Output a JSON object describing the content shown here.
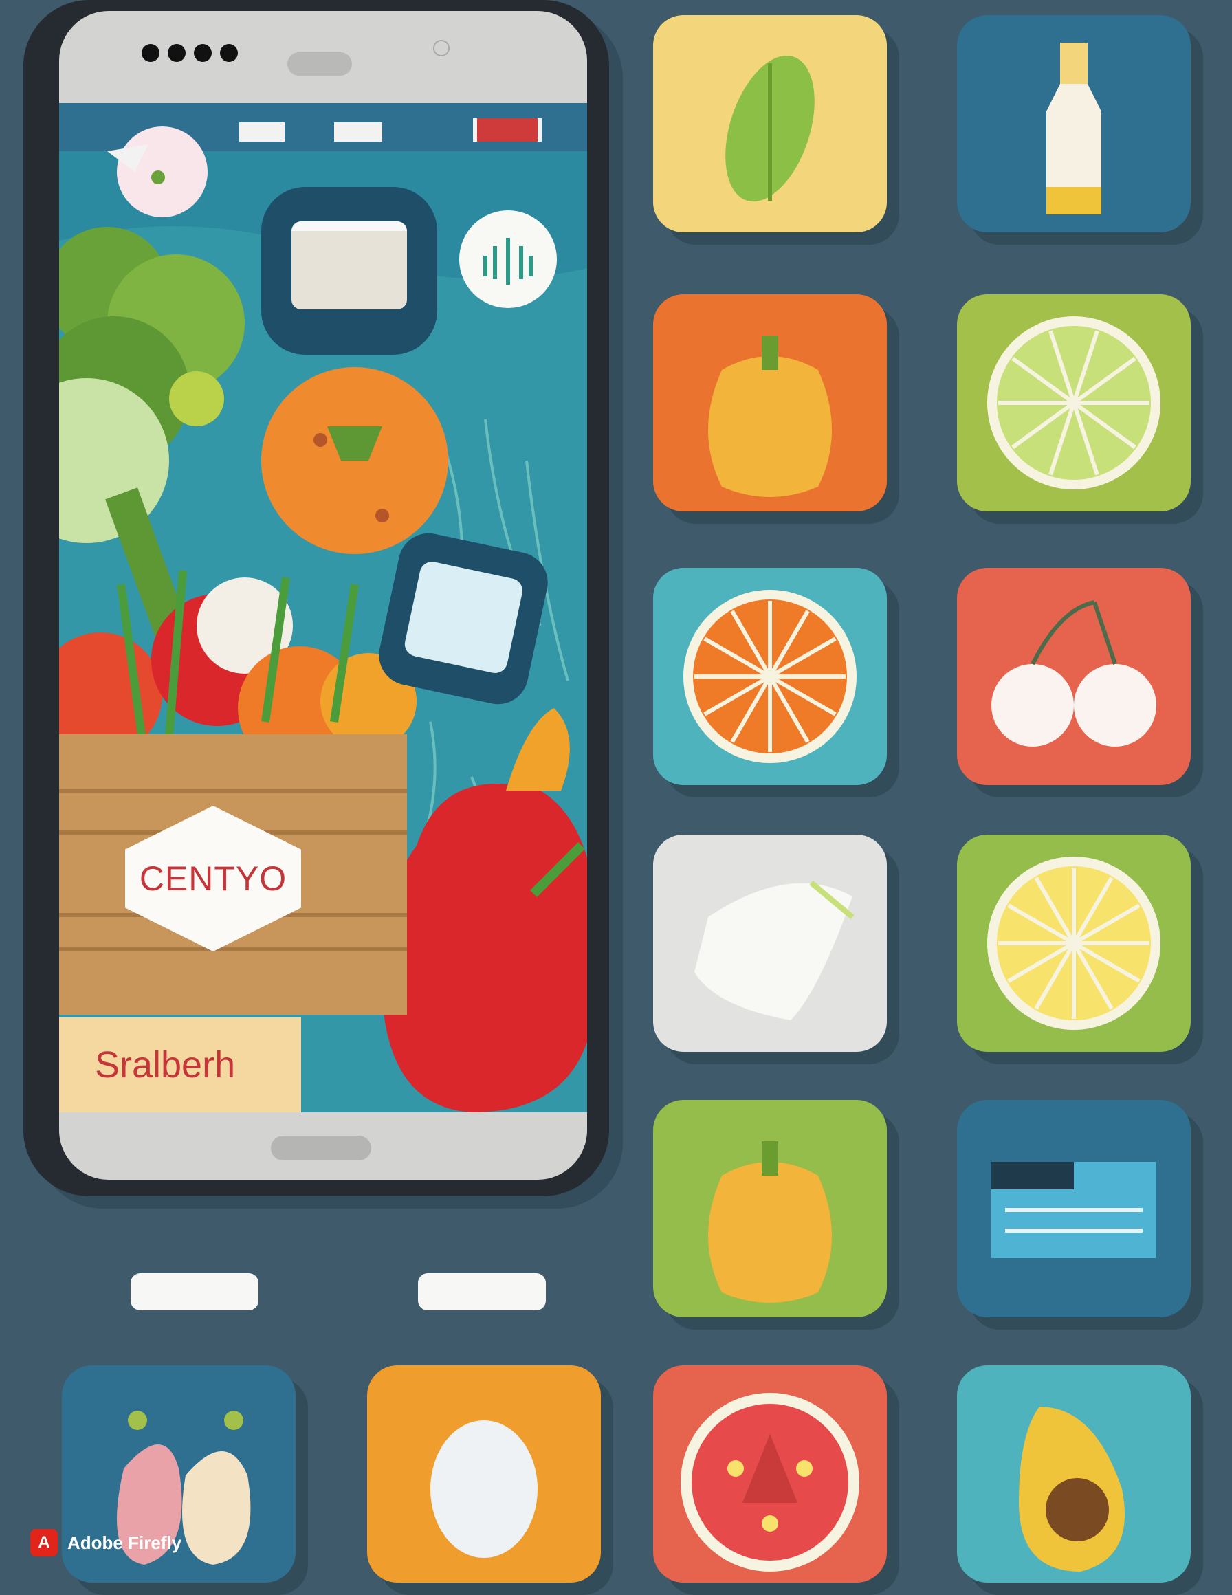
{
  "phone": {
    "crate_label": "CENTYO",
    "banner_text": "Sralberh"
  },
  "icon_tiles": [
    {
      "name": "leafy-green-icon",
      "color": "#f3d67b"
    },
    {
      "name": "bottle-icon",
      "color": "#2f6f8f"
    },
    {
      "name": "bell-pepper-icon",
      "color": "#e9732f"
    },
    {
      "name": "lime-slice-icon",
      "color": "#a3c04a"
    },
    {
      "name": "orange-slice-icon",
      "color": "#4fb3bd"
    },
    {
      "name": "cherries-icon",
      "color": "#e6644d"
    },
    {
      "name": "napkin-icon",
      "color": "#e2e2e0"
    },
    {
      "name": "lemon-slice-icon",
      "color": "#94bd4b"
    },
    {
      "name": "bell-pepper-icon",
      "color": "#94bd4b"
    },
    {
      "name": "card-icon",
      "color": "#2f6f8f"
    },
    {
      "name": "garlic-icon",
      "color": "#2f6f8f"
    },
    {
      "name": "egg-icon",
      "color": "#ef9d2c"
    },
    {
      "name": "tomato-slice-icon",
      "color": "#e6644d"
    },
    {
      "name": "avocado-icon",
      "color": "#4fb3bd"
    }
  ],
  "watermark": {
    "logo": "A",
    "text": "Adobe Firefly"
  }
}
